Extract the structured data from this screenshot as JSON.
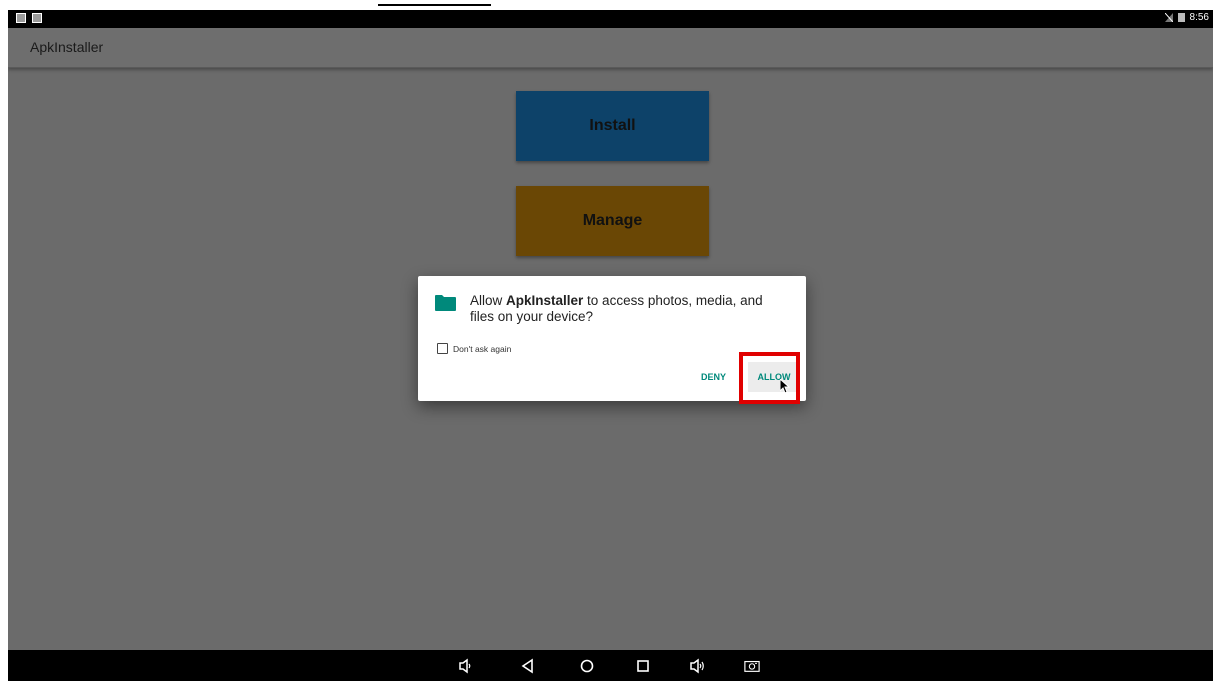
{
  "status_bar": {
    "time": "8:56"
  },
  "app_bar": {
    "title": "ApkInstaller"
  },
  "buttons": {
    "install": "Install",
    "manage": "Manage"
  },
  "dialog": {
    "message_prefix": "Allow ",
    "app_name": "ApkInstaller",
    "message_suffix": " to access photos, media, and files on your device?",
    "dont_ask_label": "Don't ask again",
    "dont_ask_checked": false,
    "deny_label": "DENY",
    "allow_label": "ALLOW",
    "icon": "folder-icon"
  },
  "nav_bar": {
    "icons": [
      "volume-down-icon",
      "back-icon",
      "home-icon",
      "recents-icon",
      "volume-up-icon",
      "screenshot-icon"
    ]
  },
  "colors": {
    "accent": "#00897b",
    "highlight": "#e00000",
    "install_bg": "#0d4269",
    "manage_bg": "#6a4705",
    "scrim": "#6b6b6b"
  }
}
